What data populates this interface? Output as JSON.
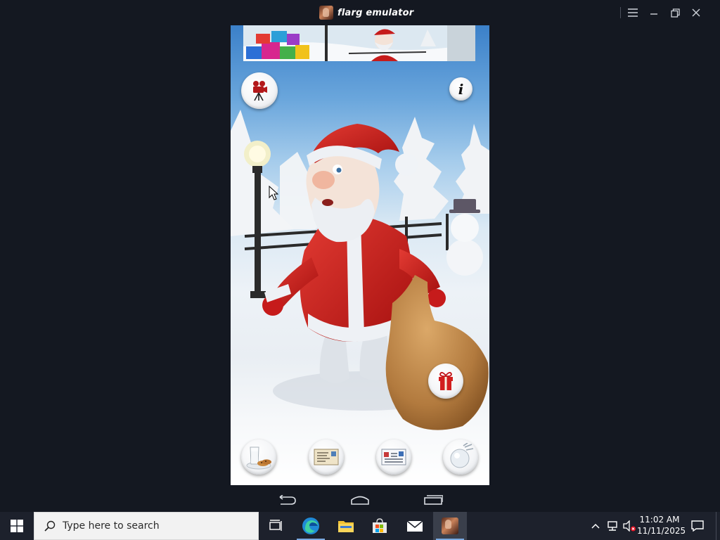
{
  "window": {
    "title": "flarg emulator"
  },
  "taskbar": {
    "search_placeholder": "Type here to search",
    "apps": [
      "task-view",
      "edge",
      "file-explorer",
      "microsoft-store",
      "mail",
      "flarg-emulator"
    ]
  },
  "clock": {
    "time": "11:02 AM",
    "date": "11/11/2025"
  },
  "phone": {
    "icons": {
      "video": "video-camera-icon",
      "info": "info-icon",
      "gift": "gift-icon",
      "milk": "milk-and-cookies-icon",
      "letter": "letter-icon",
      "card": "postcard-icon",
      "snowball": "snowball-icon"
    },
    "info_glyph": "i"
  },
  "colors": {
    "taskbar": "#1d212c",
    "window_bg": "#141821",
    "santa_red": "#c61b1b",
    "sky_top": "#3b80c9"
  }
}
